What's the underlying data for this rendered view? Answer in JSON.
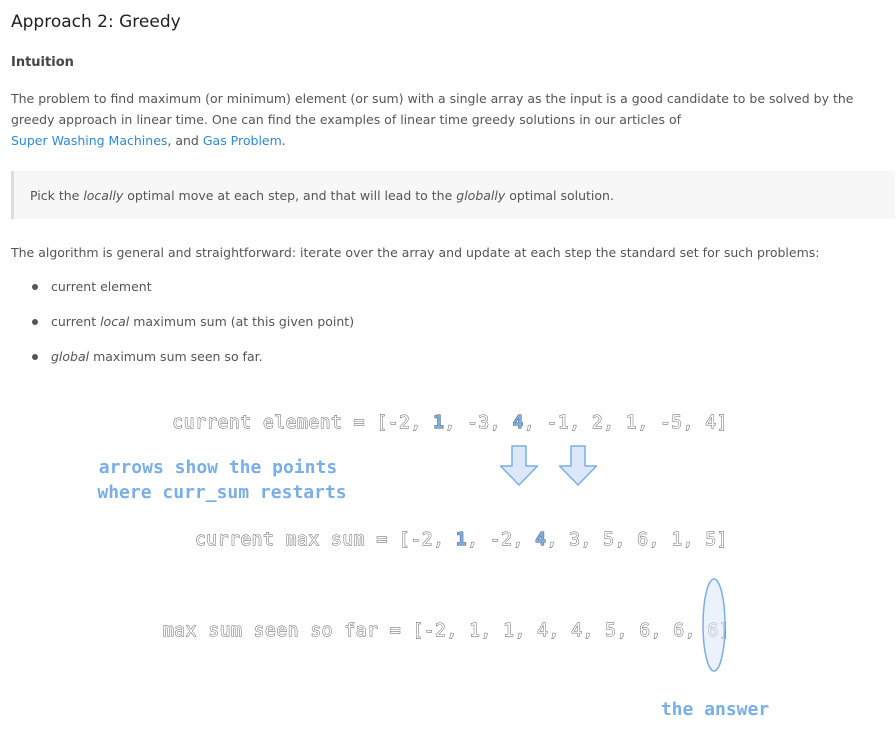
{
  "article": {
    "title": "Approach 2: Greedy",
    "subheading": "Intuition",
    "paragraph1": {
      "text_before": "The problem to find maximum (or minimum) element (or sum) with a single array as the input is a good candidate to be solved by the greedy approach in linear time. One can find the examples of linear time greedy solutions in our articles of",
      "link1": "Super Washing Machines",
      "between": ", and",
      "link2": "Gas Problem",
      "end": "."
    },
    "quote": {
      "before": "Pick the ",
      "em1": "locally",
      "middle": " optimal move at each step, and that will lead to the ",
      "em2": "globally",
      "after": " optimal solution."
    },
    "paragraph2": "The algorithm is general and straightforward: iterate over the array and update at each step the standard set for such problems:",
    "bullets": [
      {
        "before": "current element",
        "em": "",
        "after": ""
      },
      {
        "before": "current ",
        "em": "local",
        "after": " maximum sum (at this given point)"
      },
      {
        "before": "",
        "em": "global",
        "after": " maximum sum seen so far."
      }
    ]
  },
  "diagram": {
    "colors": {
      "highlight": "#7aaee6",
      "arrow_fill": "#dbe8f7",
      "arrow_stroke": "#7aaee6",
      "ellipse_fill": "#dbe8f7"
    },
    "row1": {
      "label": "current element = ",
      "values": [
        "-2",
        "1",
        "-3",
        "4",
        "-1",
        "2",
        "1",
        "-5",
        "4"
      ],
      "highlight_indices": [
        1,
        3
      ]
    },
    "row2": {
      "label": "current max sum = ",
      "values": [
        "-2",
        "1",
        "-2",
        "4",
        "3",
        "5",
        "6",
        "1",
        "5"
      ],
      "highlight_indices": [
        1,
        3
      ]
    },
    "row3": {
      "label": "max sum seen so far = ",
      "values": [
        "-2",
        "1",
        "1",
        "4",
        "4",
        "5",
        "6",
        "6",
        "6"
      ],
      "highlight_indices": []
    },
    "note_line1": "arrows show the points",
    "note_line2": "where curr_sum restarts",
    "answer_label": "the answer"
  }
}
